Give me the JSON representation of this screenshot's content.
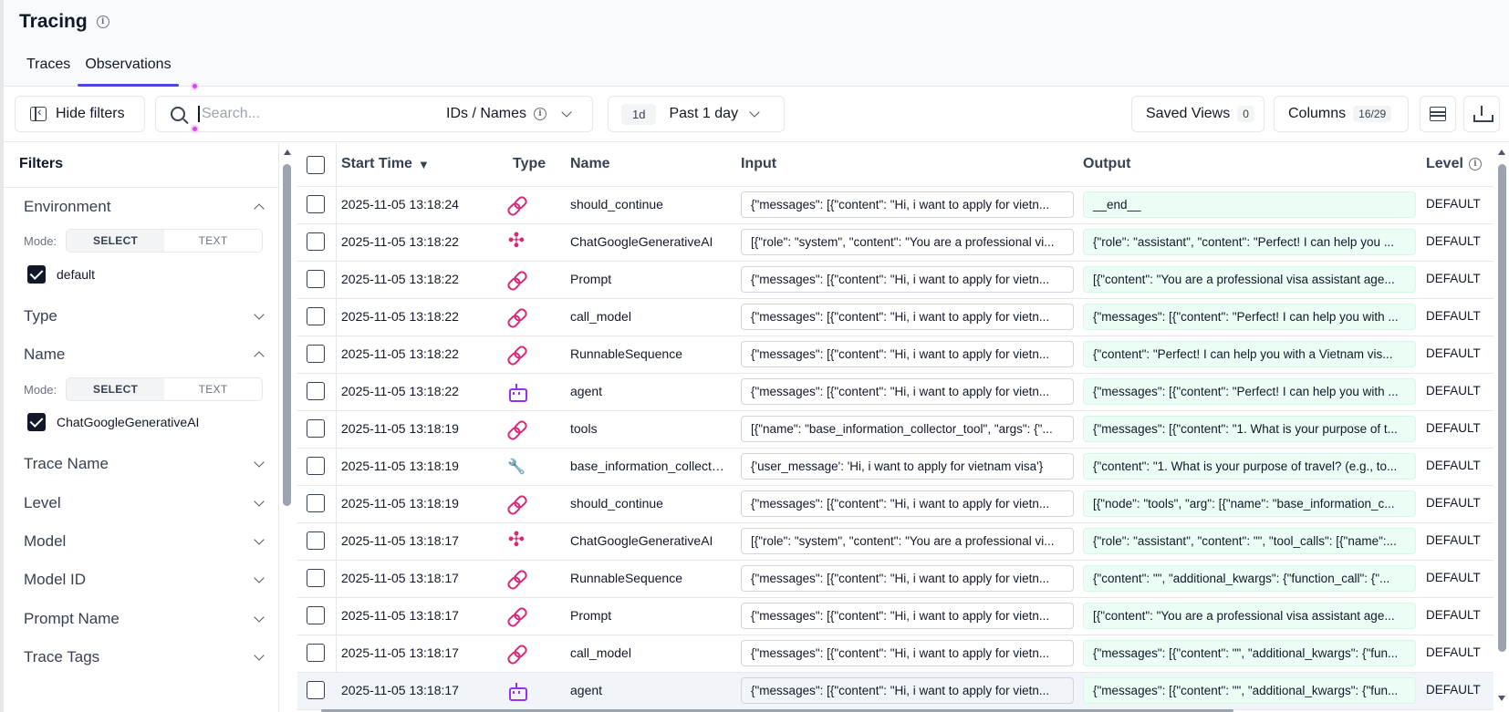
{
  "header": {
    "title": "Tracing",
    "tabs": [
      {
        "label": "Traces",
        "active": false
      },
      {
        "label": "Observations",
        "active": true
      }
    ]
  },
  "toolbar": {
    "hide_filters_label": "Hide filters",
    "search_placeholder": "Search...",
    "search_scope_label": "IDs / Names",
    "date_badge": "1d",
    "date_range_label": "Past 1 day",
    "saved_views_label": "Saved Views",
    "saved_views_count": "0",
    "columns_label": "Columns",
    "columns_count": "16/29"
  },
  "filters": {
    "title": "Filters",
    "mode_label": "Mode:",
    "mode_select": "SELECT",
    "mode_text": "TEXT",
    "environment": {
      "label": "Environment",
      "checked_value": "default"
    },
    "type": {
      "label": "Type"
    },
    "name": {
      "label": "Name",
      "checked_value": "ChatGoogleGenerativeAI"
    },
    "collapsed": [
      "Trace Name",
      "Level",
      "Model",
      "Model ID",
      "Prompt Name",
      "Trace Tags"
    ]
  },
  "table": {
    "columns": {
      "start_time": "Start Time",
      "type": "Type",
      "name": "Name",
      "input": "Input",
      "output": "Output",
      "level": "Level"
    },
    "rows": [
      {
        "time": "2025-11-05 13:18:24",
        "type": "chain",
        "name": "should_continue",
        "input": "{\"messages\": [{\"content\": \"Hi, i want to apply for vietn...",
        "output": "__end__",
        "level": "DEFAULT"
      },
      {
        "time": "2025-11-05 13:18:22",
        "type": "generation",
        "name": "ChatGoogleGenerativeAI",
        "input": "[{\"role\": \"system\", \"content\": \"You are a professional vi...",
        "output": "{\"role\": \"assistant\", \"content\": \"Perfect! I can help you ...",
        "level": "DEFAULT"
      },
      {
        "time": "2025-11-05 13:18:22",
        "type": "chain",
        "name": "Prompt",
        "input": "{\"messages\": [{\"content\": \"Hi, i want to apply for vietn...",
        "output": "[{\"content\": \"You are a professional visa assistant age...",
        "level": "DEFAULT"
      },
      {
        "time": "2025-11-05 13:18:22",
        "type": "chain",
        "name": "call_model",
        "input": "{\"messages\": [{\"content\": \"Hi, i want to apply for vietn...",
        "output": "{\"messages\": [{\"content\": \"Perfect! I can help you with ...",
        "level": "DEFAULT"
      },
      {
        "time": "2025-11-05 13:18:22",
        "type": "chain",
        "name": "RunnableSequence",
        "input": "{\"messages\": [{\"content\": \"Hi, i want to apply for vietn...",
        "output": "{\"content\": \"Perfect! I can help you with a Vietnam vis...",
        "level": "DEFAULT"
      },
      {
        "time": "2025-11-05 13:18:22",
        "type": "agent",
        "name": "agent",
        "input": "{\"messages\": [{\"content\": \"Hi, i want to apply for vietn...",
        "output": "{\"messages\": [{\"content\": \"Perfect! I can help you with ...",
        "level": "DEFAULT"
      },
      {
        "time": "2025-11-05 13:18:19",
        "type": "chain",
        "name": "tools",
        "input": "[{\"name\": \"base_information_collector_tool\", \"args\": {\"...",
        "output": "{\"messages\": [{\"content\": \"1. What is your purpose of t...",
        "level": "DEFAULT"
      },
      {
        "time": "2025-11-05 13:18:19",
        "type": "tool",
        "name": "base_information_collector...",
        "input": "{'user_message': 'Hi, i want to apply for vietnam visa'}",
        "output": "{\"content\": \"1. What is your purpose of travel? (e.g., to...",
        "level": "DEFAULT"
      },
      {
        "time": "2025-11-05 13:18:19",
        "type": "chain",
        "name": "should_continue",
        "input": "{\"messages\": [{\"content\": \"Hi, i want to apply for vietn...",
        "output": "[{\"node\": \"tools\", \"arg\": [{\"name\": \"base_information_c...",
        "level": "DEFAULT"
      },
      {
        "time": "2025-11-05 13:18:17",
        "type": "generation",
        "name": "ChatGoogleGenerativeAI",
        "input": "[{\"role\": \"system\", \"content\": \"You are a professional vi...",
        "output": "{\"role\": \"assistant\", \"content\": \"\", \"tool_calls\": [{\"name\":...",
        "level": "DEFAULT"
      },
      {
        "time": "2025-11-05 13:18:17",
        "type": "chain",
        "name": "RunnableSequence",
        "input": "{\"messages\": [{\"content\": \"Hi, i want to apply for vietn...",
        "output": "{\"content\": \"\", \"additional_kwargs\": {\"function_call\": {\"...",
        "level": "DEFAULT"
      },
      {
        "time": "2025-11-05 13:18:17",
        "type": "chain",
        "name": "Prompt",
        "input": "{\"messages\": [{\"content\": \"Hi, i want to apply for vietn...",
        "output": "[{\"content\": \"You are a professional visa assistant age...",
        "level": "DEFAULT"
      },
      {
        "time": "2025-11-05 13:18:17",
        "type": "chain",
        "name": "call_model",
        "input": "{\"messages\": [{\"content\": \"Hi, i want to apply for vietn...",
        "output": "{\"messages\": [{\"content\": \"\", \"additional_kwargs\": {\"fun...",
        "level": "DEFAULT"
      },
      {
        "time": "2025-11-05 13:18:17",
        "type": "agent",
        "name": "agent",
        "input": "{\"messages\": [{\"content\": \"Hi, i want to apply for vietn...",
        "output": "{\"messages\": [{\"content\": \"\", \"additional_kwargs\": {\"fun...",
        "level": "DEFAULT"
      }
    ]
  },
  "colors": {
    "accent": "#4f46e5",
    "chain_icon": "#db2777",
    "agent_icon": "#9333ea",
    "tool_icon": "#ea580c",
    "output_bg": "#ecfdf5"
  }
}
